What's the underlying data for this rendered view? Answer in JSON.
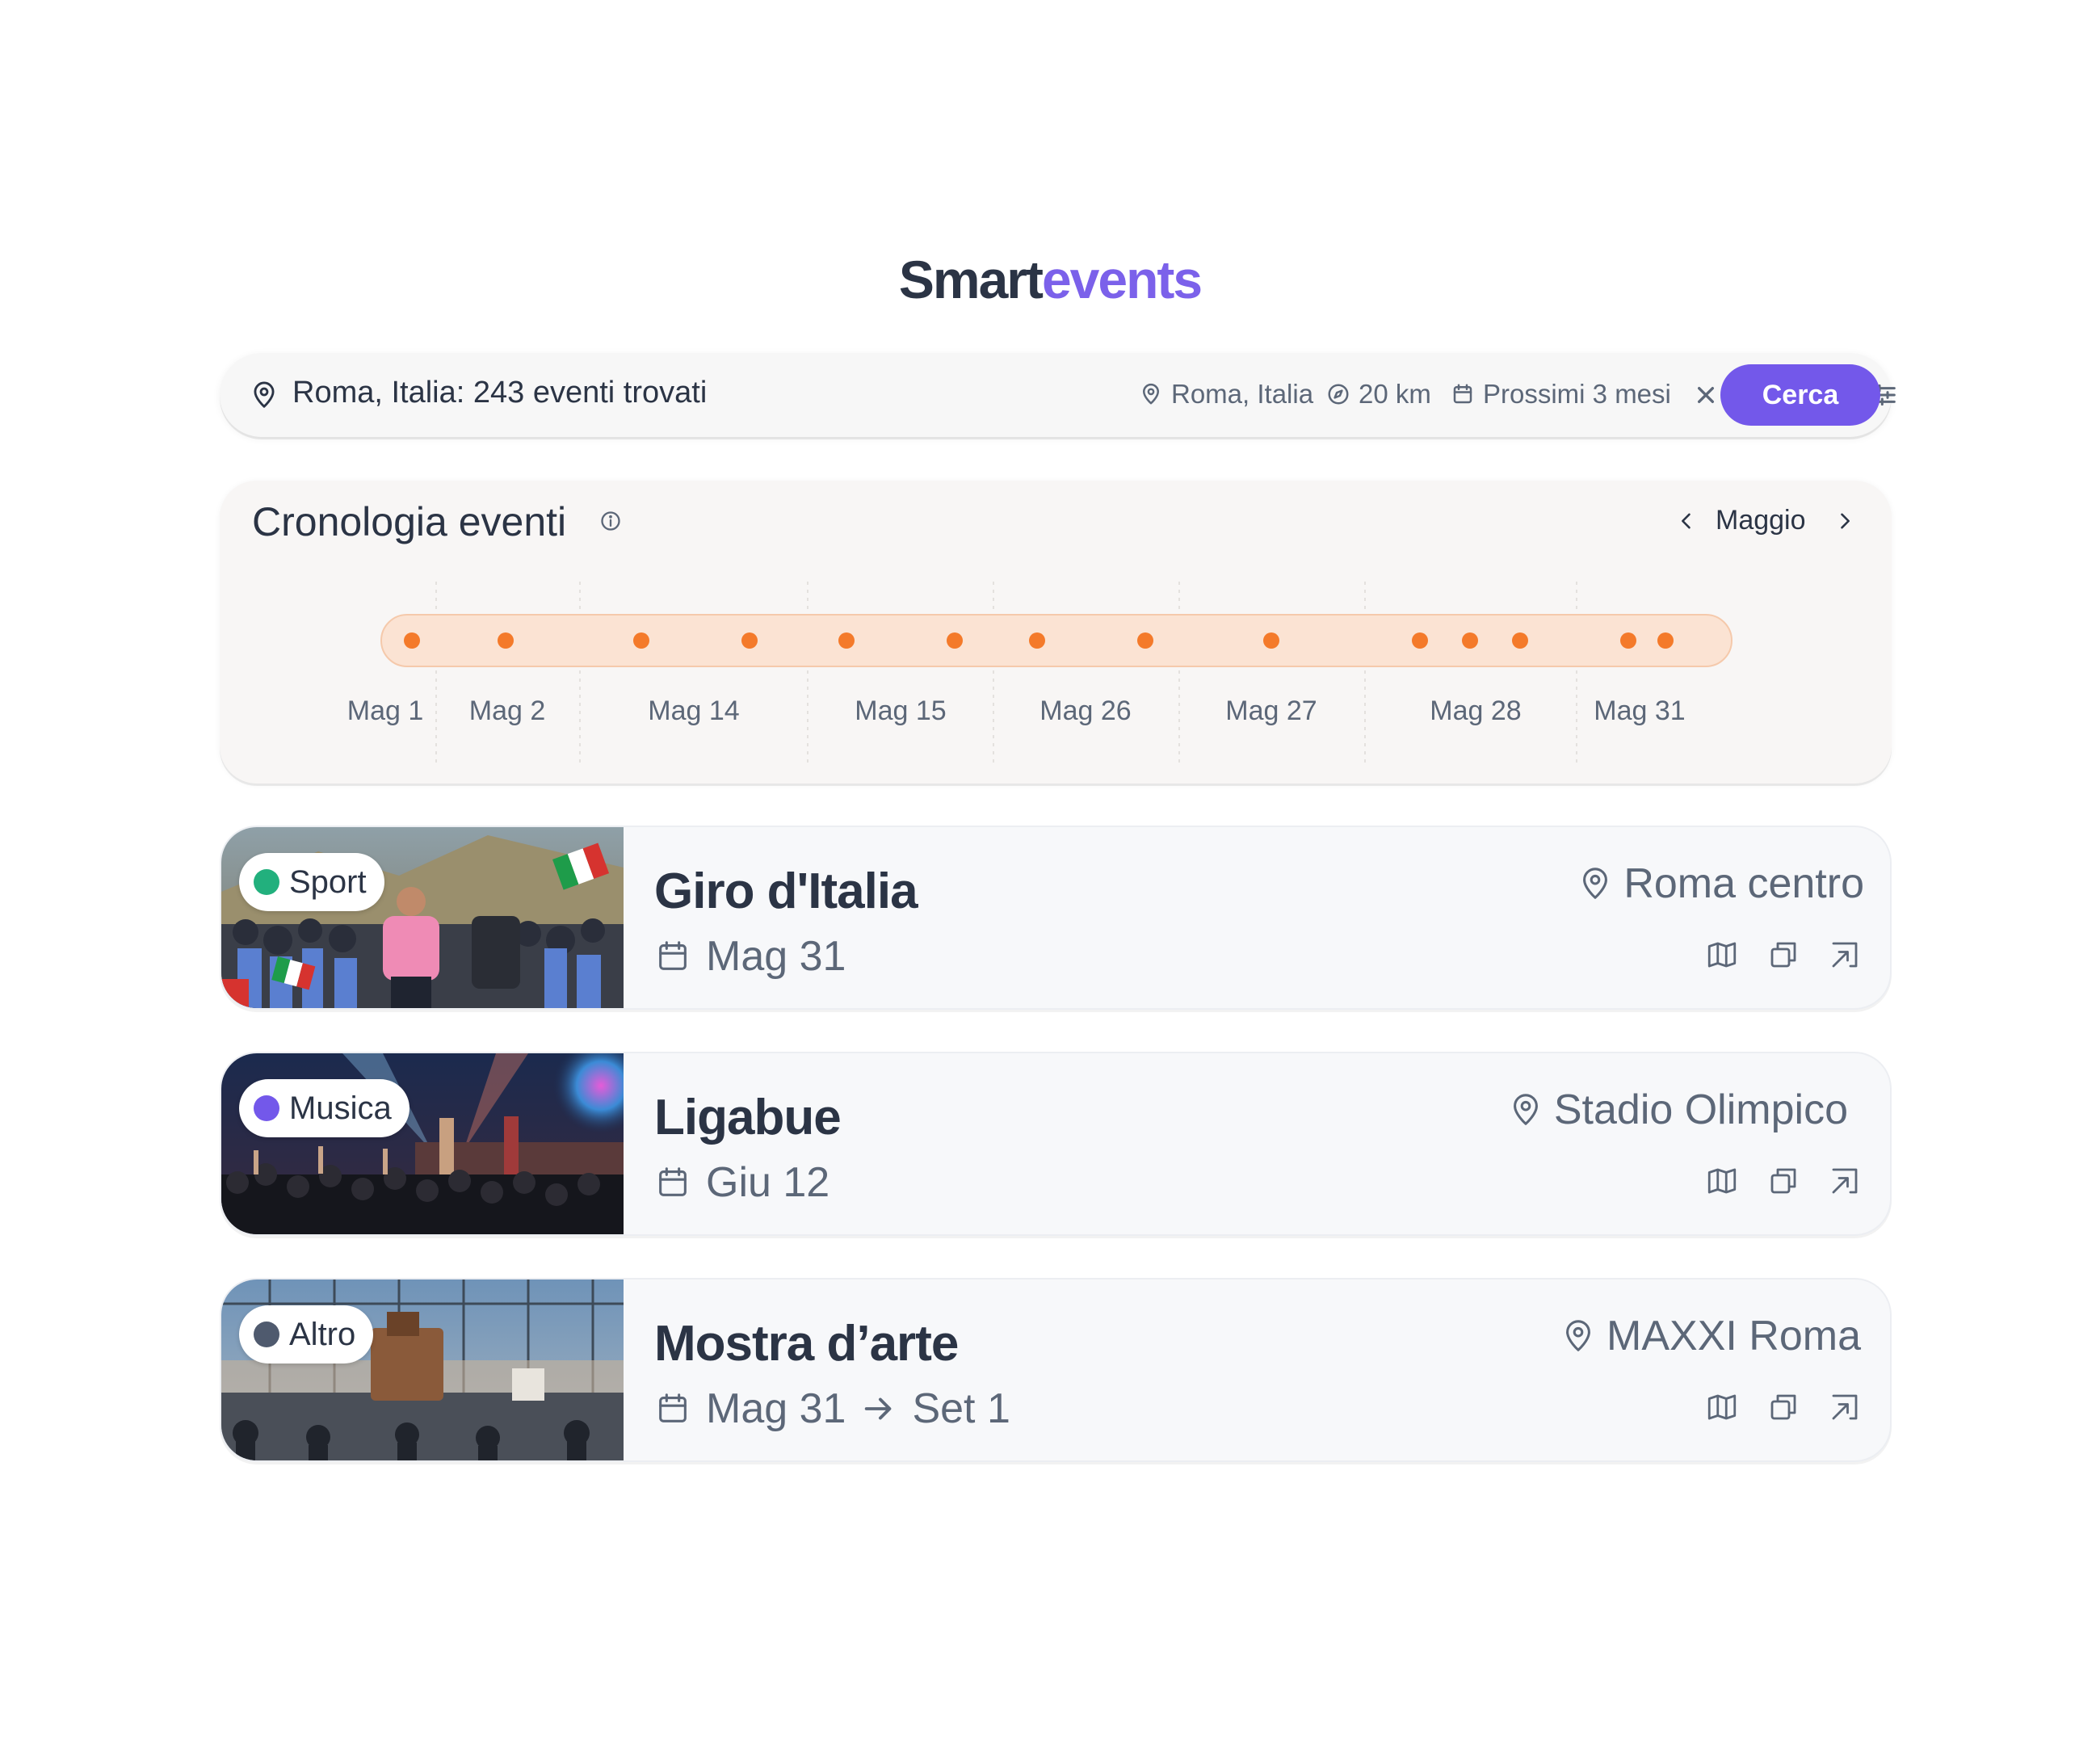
{
  "logo": {
    "part1": "Smart",
    "part2": "events"
  },
  "search": {
    "result": "Roma, Italia: 243 eventi trovati",
    "location": "Roma, Italia",
    "radius": "20 km",
    "period": "Prossimi 3 mesi",
    "submit_label": "Cerca"
  },
  "timeline": {
    "title": "Cronologia eventi",
    "month": "Maggio",
    "date_labels": [
      "Mag 1",
      "Mag 2",
      "Mag 14",
      "Mag 15",
      "Mag 26",
      "Mag 27",
      "Mag 28",
      "Mag 31"
    ]
  },
  "events": [
    {
      "category": "Sport",
      "category_color": "#22b07d",
      "title": "Giro d'Italia",
      "date": "Mag 31",
      "date_end": "",
      "location": "Roma centro"
    },
    {
      "category": "Musica",
      "category_color": "#7358ea",
      "title": "Ligabue",
      "date": "Giu 12",
      "date_end": "",
      "location": "Stadio Olimpico"
    },
    {
      "category": "Altro",
      "category_color": "#4f5a6e",
      "title": "Mostra d’arte",
      "date": "Mag 31",
      "date_end": "Set 1",
      "location": "MAXXI Roma"
    }
  ],
  "colors": {
    "accent": "#7358ea",
    "timeline_dot": "#f47a2a",
    "timeline_band": "#fbe3d3"
  }
}
